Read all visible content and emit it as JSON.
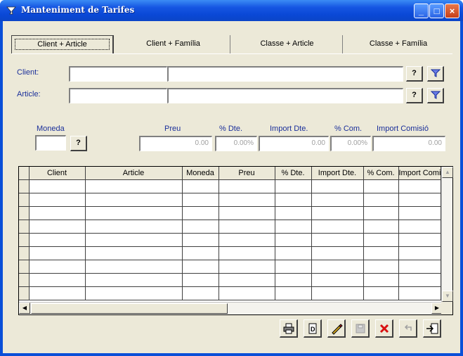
{
  "window": {
    "title": "Manteniment de Tarifes",
    "minimize_glyph": "_",
    "maximize_glyph": "□",
    "close_glyph": "×"
  },
  "tabs": [
    {
      "label": "Client + Article",
      "active": true
    },
    {
      "label": "Client + Família",
      "active": false
    },
    {
      "label": "Classe + Article",
      "active": false
    },
    {
      "label": "Classe + Família",
      "active": false
    }
  ],
  "filters": {
    "client_label": "Client:",
    "article_label": "Article:",
    "client_code": "",
    "client_name": "",
    "article_code": "",
    "article_name": "",
    "lookup_label": "?",
    "filter_icon": "filter-icon"
  },
  "pricing": {
    "moneda_label": "Moneda",
    "moneda_value": "",
    "moneda_lookup": "?",
    "preu_label": "Preu",
    "preu_value": "0.00",
    "dte_label": "% Dte.",
    "dte_value": "0.00%",
    "import_dte_label": "Import Dte.",
    "import_dte_value": "0.00",
    "com_label": "% Com.",
    "com_value": "0.00%",
    "import_com_label": "Import Comisió",
    "import_com_value": "0.00"
  },
  "grid": {
    "columns": [
      "Client",
      "Article",
      "Moneda",
      "Preu",
      "% Dte.",
      "Import Dte.",
      "% Com.",
      "Import Comi"
    ],
    "row_count": 9
  },
  "toolbar": {
    "buttons": [
      "print-icon",
      "new-icon",
      "edit-icon",
      "save-icon",
      "delete-icon",
      "undo-icon",
      "exit-icon"
    ]
  },
  "colors": {
    "titlebar": "#0a48d6",
    "face": "#ece9d8",
    "label_blue": "#1a2f9a",
    "delete_red": "#d81010"
  }
}
